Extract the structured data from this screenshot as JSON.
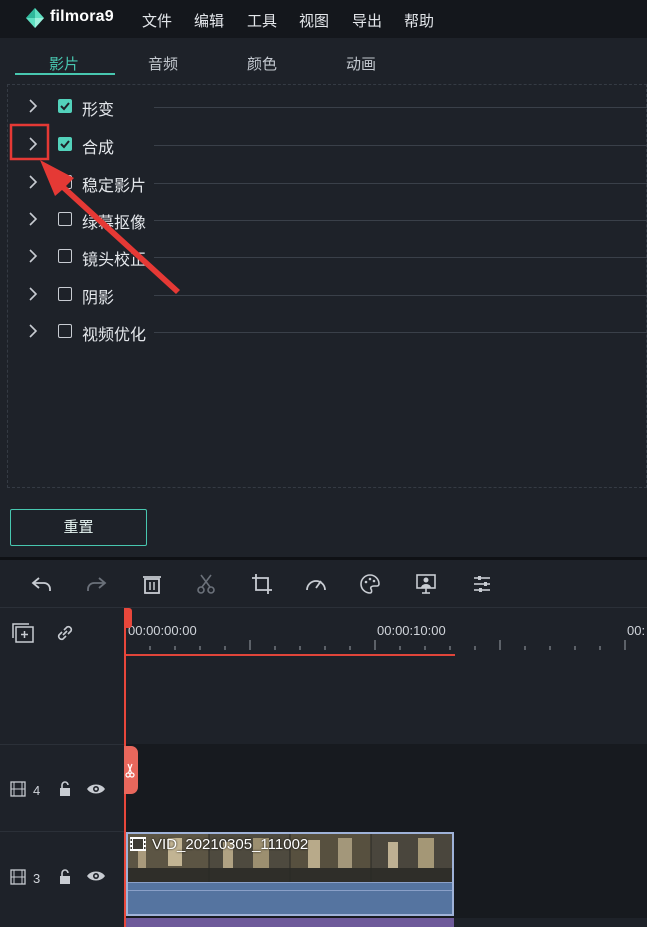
{
  "app": {
    "brand": "filmora9",
    "menu": [
      "文件",
      "编辑",
      "工具",
      "视图",
      "导出",
      "帮助"
    ]
  },
  "tabs": [
    "影片",
    "音频",
    "颜色",
    "动画"
  ],
  "active_tab": 0,
  "properties": [
    {
      "label": "形变",
      "checked": true
    },
    {
      "label": "合成",
      "checked": true
    },
    {
      "label": "稳定影片",
      "checked": false
    },
    {
      "label": "绿幕抠像",
      "checked": false
    },
    {
      "label": "镜头校正",
      "checked": false
    },
    {
      "label": "阴影",
      "checked": false
    },
    {
      "label": "视频优化",
      "checked": false
    }
  ],
  "reset_label": "重置",
  "toolbar": [
    "undo-icon",
    "redo-icon",
    "delete-icon",
    "cut-icon",
    "crop-icon",
    "speed-icon",
    "color-icon",
    "green-screen-icon",
    "audio-mixer-icon"
  ],
  "ruler": {
    "t0": "00:00:00:00",
    "t1": "00:00:10:00",
    "t2": "00:"
  },
  "tracks": [
    {
      "number": "4"
    },
    {
      "number": "3"
    }
  ],
  "clip": {
    "title": "VID_20210305_111002"
  },
  "colors": {
    "accent": "#48c7b0",
    "playhead": "#e8473b",
    "annotation": "#e53935"
  }
}
